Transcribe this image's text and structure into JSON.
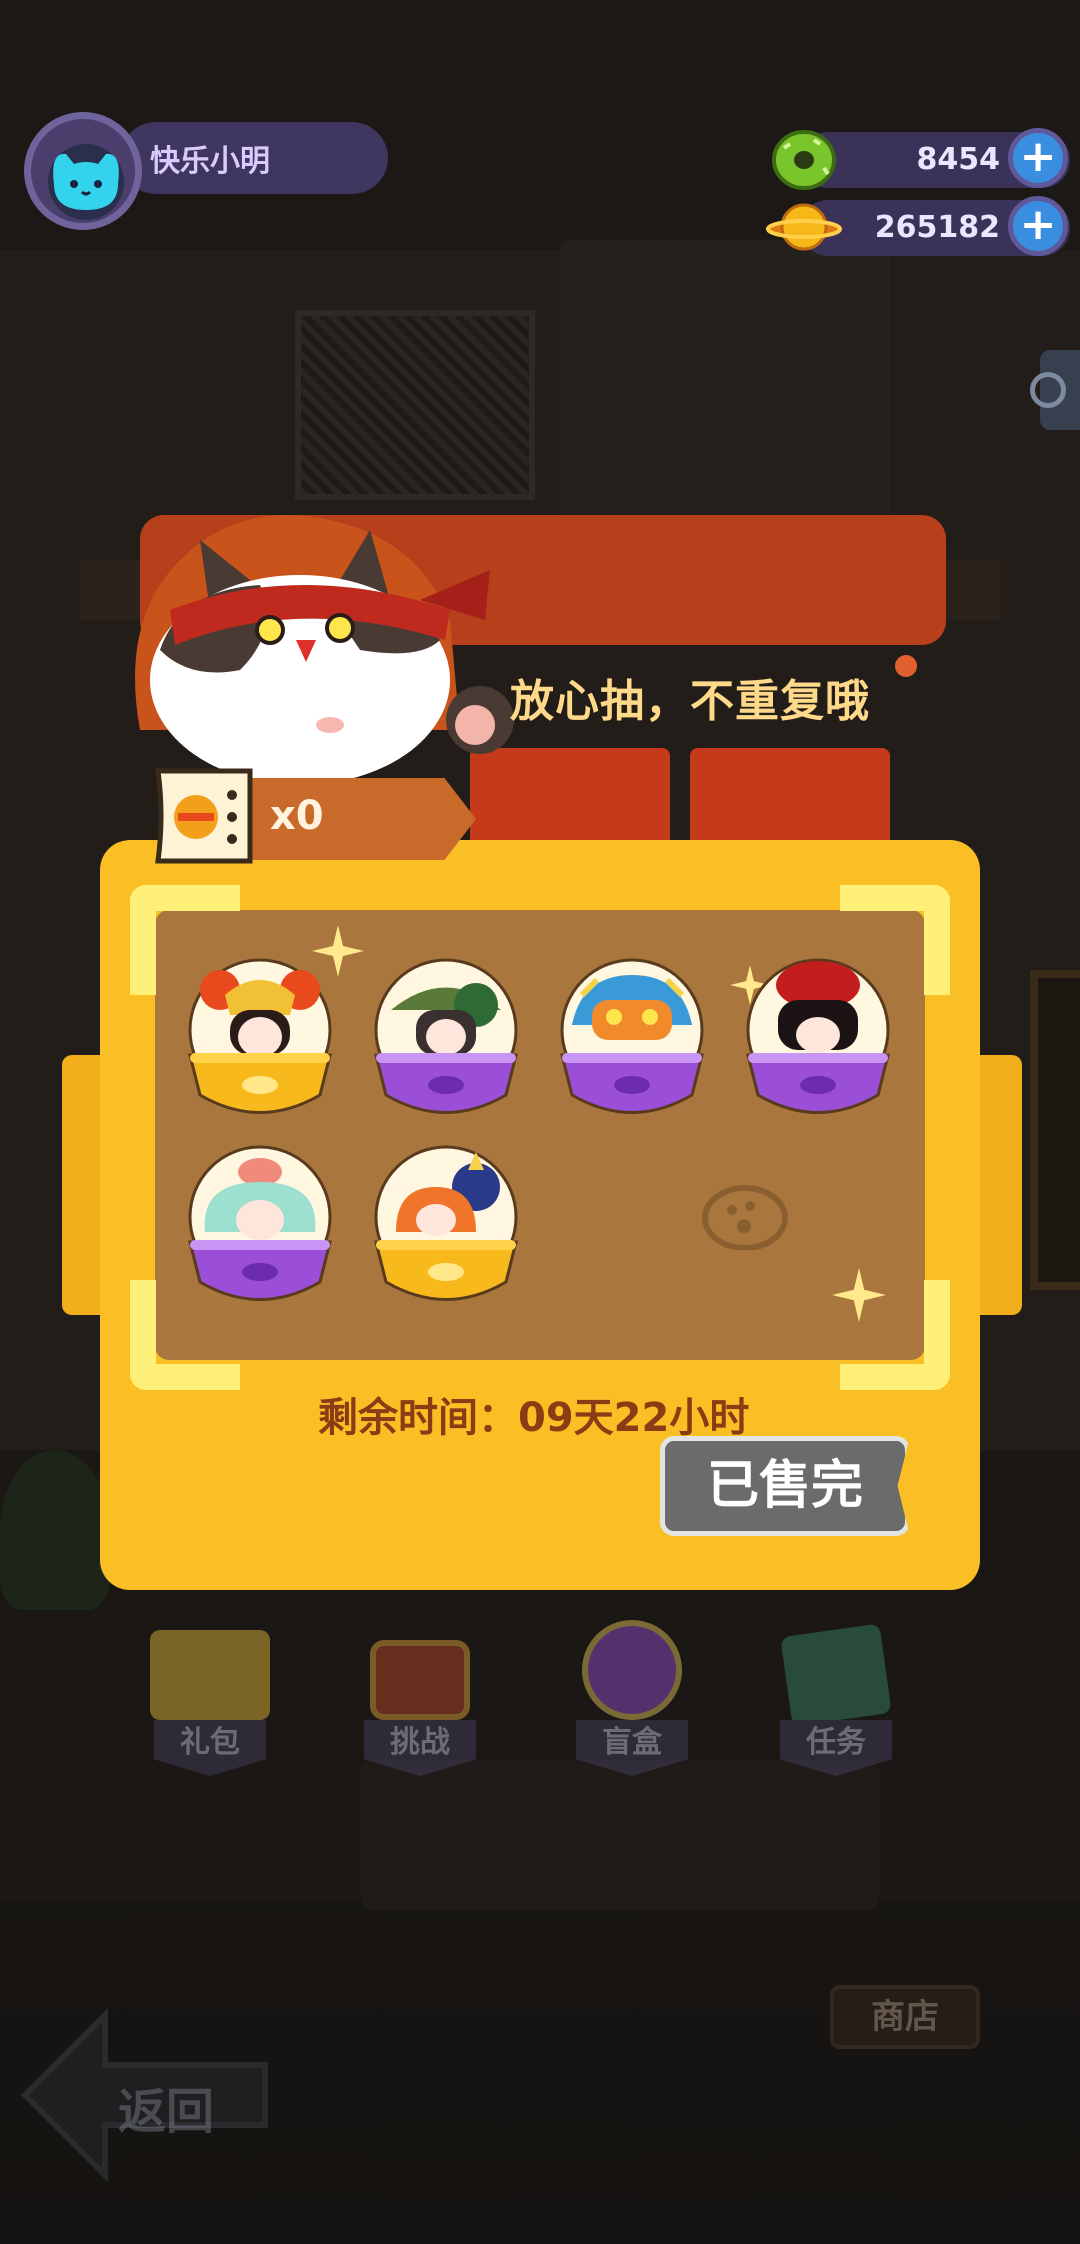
{
  "player": {
    "name": "快乐小明"
  },
  "currencies": [
    {
      "icon": "green-donut-icon",
      "value": "8454"
    },
    {
      "icon": "gold-planet-coin-icon",
      "value": "265182"
    }
  ],
  "popup": {
    "slogan": "放心抽，不重复哦",
    "ticket_count": "x0",
    "items": [
      {
        "name": "peking-opera-doll",
        "bowl": "gold"
      },
      {
        "name": "bamboo-hat-doll",
        "bowl": "purple"
      },
      {
        "name": "lion-dance-doll",
        "bowl": "purple"
      },
      {
        "name": "red-hat-doll",
        "bowl": "purple"
      },
      {
        "name": "mint-cloud-doll",
        "bowl": "purple"
      },
      {
        "name": "fox-duo-doll",
        "bowl": "gold"
      }
    ],
    "remaining_time": "剩余时间：09天22小时",
    "sold_out_label": "已售完"
  },
  "nav": [
    {
      "label": "礼包",
      "icon": "gift-box-icon"
    },
    {
      "label": "挑战",
      "icon": "tv-icon"
    },
    {
      "label": "盲盒",
      "icon": "capsule-icon"
    },
    {
      "label": "任务",
      "icon": "task-board-icon"
    }
  ],
  "footer": {
    "back_label": "返回",
    "shop_label": "商店"
  },
  "colors": {
    "panel": "#fbbf26",
    "inner": "#a9773e",
    "header": "#b6401b",
    "accent_text": "#ffd98a",
    "gold_bowl": "#f7b91c",
    "purple_bowl": "#9b4fd8"
  }
}
